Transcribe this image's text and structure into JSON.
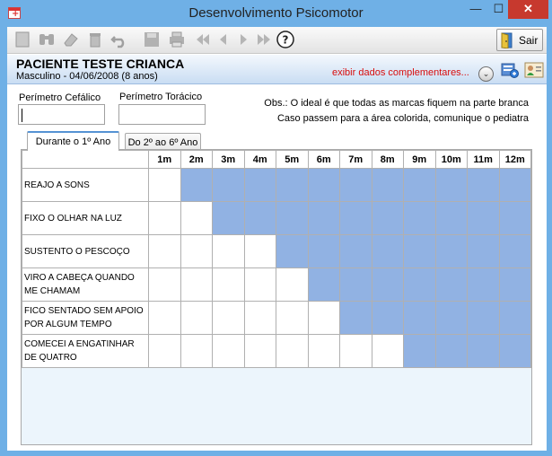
{
  "window": {
    "title": "Desenvolvimento Psicomotor",
    "minimize": "—",
    "maximize": "☐",
    "close": "✕"
  },
  "toolbar": {
    "sair_label": "Sair"
  },
  "patient": {
    "name": "PACIENTE TESTE CRIANCA",
    "details": "Masculino - 04/06/2008 (8 anos)",
    "exibir_link": "exibir dados complementares...",
    "expand_symbol": "⌄"
  },
  "fields": {
    "perimetro_cefalico_label": "Perímetro Cefálico",
    "perimetro_cefalico_value": "",
    "perimetro_toracico_label": "Perímetro Torácico",
    "perimetro_toracico_value": ""
  },
  "obs": {
    "line1": "Obs.: O ideal é que todas as marcas fiquem na parte branca",
    "line2": "Caso passem para a área colorida, comunique o pediatra"
  },
  "tabs": [
    {
      "label": "Durante o 1º Ano",
      "active": true
    },
    {
      "label": "Do 2º ao 6º Ano",
      "active": false
    }
  ],
  "grid": {
    "months": [
      "1m",
      "2m",
      "3m",
      "4m",
      "5m",
      "6m",
      "7m",
      "8m",
      "9m",
      "10m",
      "11m",
      "12m"
    ],
    "milestones": [
      {
        "label": "REAJO A SONS",
        "blue_from": 2
      },
      {
        "label": "FIXO O OLHAR NA LUZ",
        "blue_from": 3
      },
      {
        "label": "SUSTENTO O PESCOÇO",
        "blue_from": 5
      },
      {
        "label": "VIRO A CABEÇA QUANDO ME CHAMAM",
        "blue_from": 6
      },
      {
        "label": "FICO SENTADO SEM APOIO POR ALGUM TEMPO",
        "blue_from": 7
      },
      {
        "label": "COMECEI A ENGATINHAR DE QUATRO",
        "blue_from": 9
      }
    ]
  },
  "colors": {
    "titlebar": "#6fb0e6",
    "close_button": "#c7392e",
    "grid_blue": "#91b2e3",
    "link_red": "#d80d0d"
  }
}
